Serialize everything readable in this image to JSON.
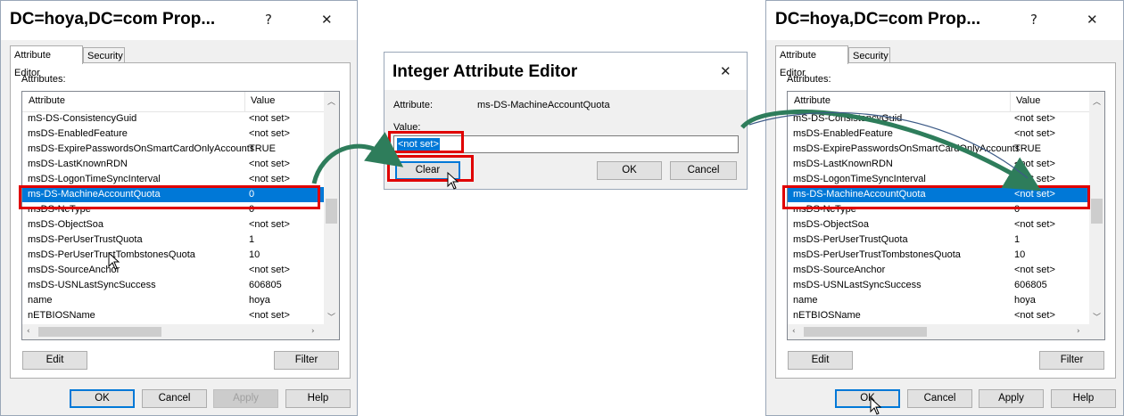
{
  "left_dialog": {
    "title": "DC=hoya,DC=com Prop...",
    "help_icon": "?",
    "close_icon": "✕",
    "tabs": [
      "Attribute Editor",
      "Security"
    ],
    "attributes_label": "Attributes:",
    "columns": [
      "Attribute",
      "Value"
    ],
    "rows": [
      {
        "attr": "mS-DS-ConsistencyGuid",
        "value": "<not set>"
      },
      {
        "attr": "msDS-EnabledFeature",
        "value": "<not set>"
      },
      {
        "attr": "msDS-ExpirePasswordsOnSmartCardOnlyAccounts",
        "value": "TRUE"
      },
      {
        "attr": "msDS-LastKnownRDN",
        "value": "<not set>"
      },
      {
        "attr": "msDS-LogonTimeSyncInterval",
        "value": "<not set>"
      },
      {
        "attr": "ms-DS-MachineAccountQuota",
        "value": "0"
      },
      {
        "attr": "msDS-NcType",
        "value": "0"
      },
      {
        "attr": "msDS-ObjectSoa",
        "value": "<not set>"
      },
      {
        "attr": "msDS-PerUserTrustQuota",
        "value": "1"
      },
      {
        "attr": "msDS-PerUserTrustTombstonesQuota",
        "value": "10"
      },
      {
        "attr": "msDS-SourceAnchor",
        "value": "<not set>"
      },
      {
        "attr": "msDS-USNLastSyncSuccess",
        "value": "606805"
      },
      {
        "attr": "name",
        "value": "hoya"
      },
      {
        "attr": "nETBIOSName",
        "value": "<not set>"
      }
    ],
    "edit_label": "Edit",
    "filter_label": "Filter",
    "ok_label": "OK",
    "cancel_label": "Cancel",
    "apply_label": "Apply",
    "help_label": "Help"
  },
  "middle_dialog": {
    "title": "Integer Attribute Editor",
    "close_icon": "✕",
    "attribute_label": "Attribute:",
    "attribute_value": "ms-DS-MachineAccountQuota",
    "value_label": "Value:",
    "value_text": "<not set>",
    "clear_label": "Clear",
    "ok_label": "OK",
    "cancel_label": "Cancel"
  },
  "right_dialog": {
    "title": "DC=hoya,DC=com Prop...",
    "help_icon": "?",
    "close_icon": "✕",
    "tabs": [
      "Attribute Editor",
      "Security"
    ],
    "attributes_label": "Attributes:",
    "columns": [
      "Attribute",
      "Value"
    ],
    "rows": [
      {
        "attr": "mS-DS-ConsistencyGuid",
        "value": "<not set>"
      },
      {
        "attr": "msDS-EnabledFeature",
        "value": "<not set>"
      },
      {
        "attr": "msDS-ExpirePasswordsOnSmartCardOnlyAccounts",
        "value": "TRUE"
      },
      {
        "attr": "msDS-LastKnownRDN",
        "value": "<not set>"
      },
      {
        "attr": "msDS-LogonTimeSyncInterval",
        "value": "<not set>"
      },
      {
        "attr": "ms-DS-MachineAccountQuota",
        "value": "<not set>"
      },
      {
        "attr": "msDS-NcType",
        "value": "0"
      },
      {
        "attr": "msDS-ObjectSoa",
        "value": "<not set>"
      },
      {
        "attr": "msDS-PerUserTrustQuota",
        "value": "1"
      },
      {
        "attr": "msDS-PerUserTrustTombstonesQuota",
        "value": "10"
      },
      {
        "attr": "msDS-SourceAnchor",
        "value": "<not set>"
      },
      {
        "attr": "msDS-USNLastSyncSuccess",
        "value": "606805"
      },
      {
        "attr": "name",
        "value": "hoya"
      },
      {
        "attr": "nETBIOSName",
        "value": "<not set>"
      }
    ],
    "edit_label": "Edit",
    "filter_label": "Filter",
    "ok_label": "OK",
    "cancel_label": "Cancel",
    "apply_label": "Apply",
    "help_label": "Help"
  },
  "colors": {
    "selection": "#0078d7",
    "highlight_box": "#e00000",
    "arrow": "#2e7d5b"
  }
}
